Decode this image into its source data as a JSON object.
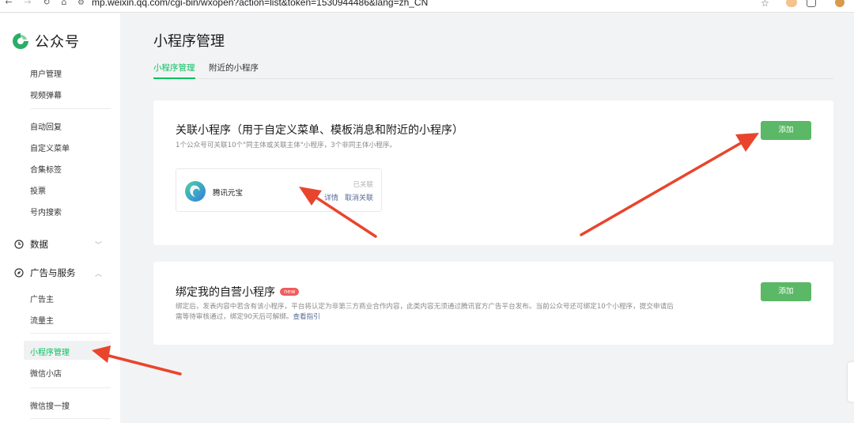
{
  "browser": {
    "url": "mp.weixin.qq.com/cgi-bin/wxopen?action=list&token=1530944486&lang=zh_CN",
    "nav_icons": [
      "back-icon",
      "forward-icon",
      "reload-icon",
      "home-icon"
    ]
  },
  "sidebar": {
    "logo_text": "公众号",
    "items_top": [
      "用户管理",
      "视频弹幕"
    ],
    "items_mid": [
      "自动回复",
      "自定义菜单",
      "合集标签",
      "投票",
      "号内搜索"
    ],
    "group_data": "数据",
    "group_ads": "广告与服务",
    "items_ads": [
      "广告主",
      "流量主"
    ],
    "active_item": "小程序管理",
    "item_shop": "微信小店",
    "item_search": "微信搜一搜"
  },
  "main": {
    "title": "小程序管理",
    "tabs": [
      {
        "label": "小程序管理",
        "active": true
      },
      {
        "label": "附近的小程序",
        "active": false
      }
    ],
    "linked_card": {
      "title": "关联小程序（用于自定义菜单、模板消息和附近的小程序）",
      "desc": "1个公众号可关联10个\"同主体或关联主体\"小程序，3个非同主体小程序。",
      "add_label": "添加",
      "app": {
        "name": "腾讯元宝",
        "status": "已关联",
        "action_detail": "详情",
        "action_unlink": "取消关联"
      }
    },
    "own_card": {
      "title": "绑定我的自营小程序",
      "badge": "new",
      "desc_line1": "绑定后，发表内容中若含有该小程序，平台将认定为非第三方商业合作内容，此类内容无须通过腾讯官方广告平台发布。当前公众号还可绑定10个小程序，提交申请后",
      "desc_line2": "需等待审核通过，绑定90天后可解绑。",
      "guide_link": "查看指引",
      "add_label": "添加"
    }
  },
  "colors": {
    "accent_green": "#07c160",
    "button_green": "#5bb866",
    "link_blue": "#576b95",
    "badge_red": "#f25b5b",
    "arrow_red": "#e8452c"
  }
}
